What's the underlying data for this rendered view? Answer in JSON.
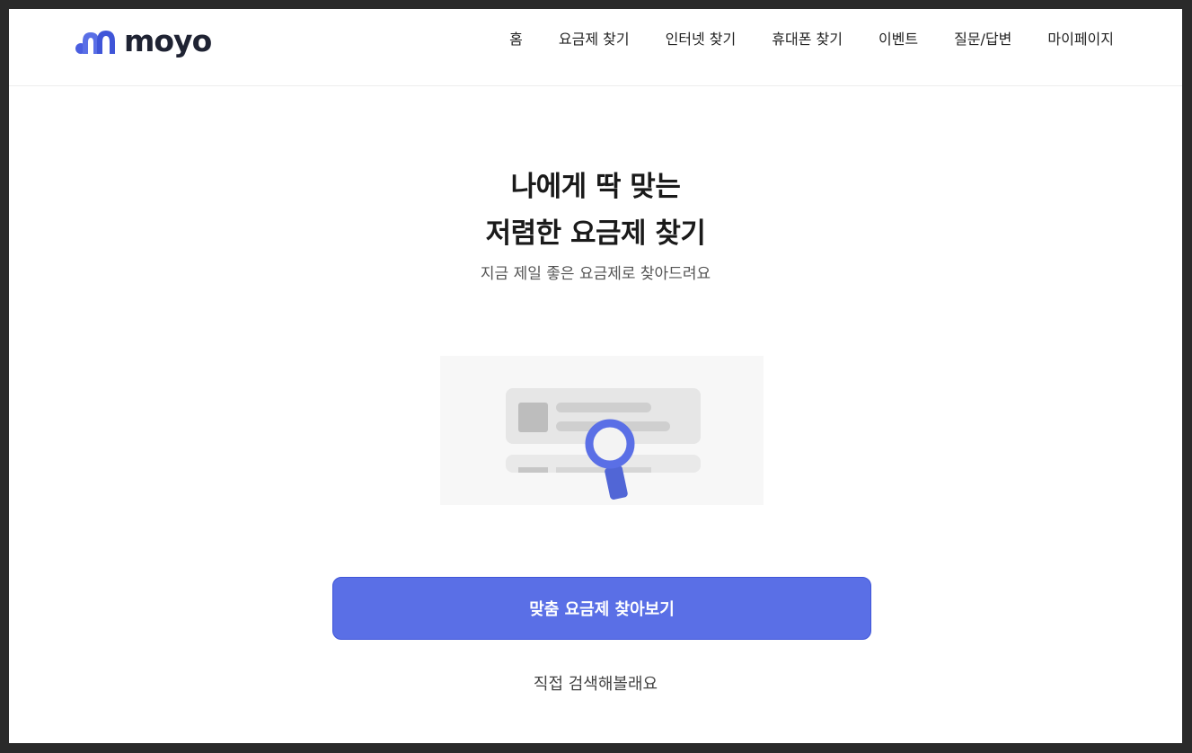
{
  "brand": {
    "name": "moyo",
    "accent": "#5a6fe6",
    "logo_icon": "moyo-logo-icon"
  },
  "nav": {
    "items": [
      {
        "label": "홈"
      },
      {
        "label": "요금제 찾기"
      },
      {
        "label": "인터넷 찾기"
      },
      {
        "label": "휴대폰 찾기"
      },
      {
        "label": "이벤트"
      },
      {
        "label": "질문/답변"
      },
      {
        "label": "마이페이지"
      }
    ]
  },
  "hero": {
    "title_line1": "나에게 딱 맞는",
    "title_line2": "저렴한 요금제 찾기",
    "subtitle": "지금 제일 좋은 요금제로 찾아드려요",
    "illustration_icon": "magnifier-over-list-icon"
  },
  "actions": {
    "primary_label": "맞춤 요금제 찾아보기",
    "secondary_label": "직접 검색해볼래요"
  }
}
